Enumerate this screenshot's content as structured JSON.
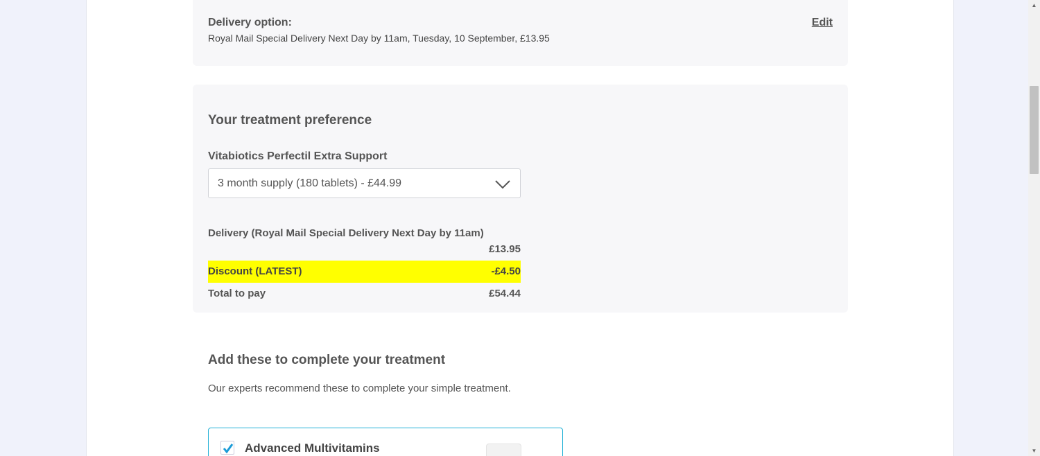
{
  "delivery": {
    "label": "Delivery option:",
    "value": "Royal Mail Special Delivery Next Day by 11am, Tuesday, 10 September, £13.95",
    "edit_label": "Edit"
  },
  "treatment": {
    "title": "Your treatment preference",
    "product_name": "Vitabiotics Perfectil Extra Support",
    "selected_option": "3 month supply (180 tablets) - £44.99",
    "delivery_line_label": "Delivery (Royal Mail Special Delivery Next Day by 11am)",
    "delivery_line_value": "£13.95",
    "discount_label": "Discount (LATEST)",
    "discount_value": "-£4.50",
    "total_label": "Total to pay",
    "total_value": "£54.44"
  },
  "addons": {
    "title": "Add these to complete your treatment",
    "subtitle": "Our experts recommend these to complete your simple treatment.",
    "items": [
      {
        "name": "Advanced Multivitamins",
        "checked": true
      }
    ]
  },
  "colors": {
    "highlight": "#ffff00",
    "card_border": "#1fb0d6",
    "check": "#1a9bd7"
  },
  "icons": {
    "dropdown": "chevron-down-icon",
    "checkbox": "checkmark-icon"
  }
}
